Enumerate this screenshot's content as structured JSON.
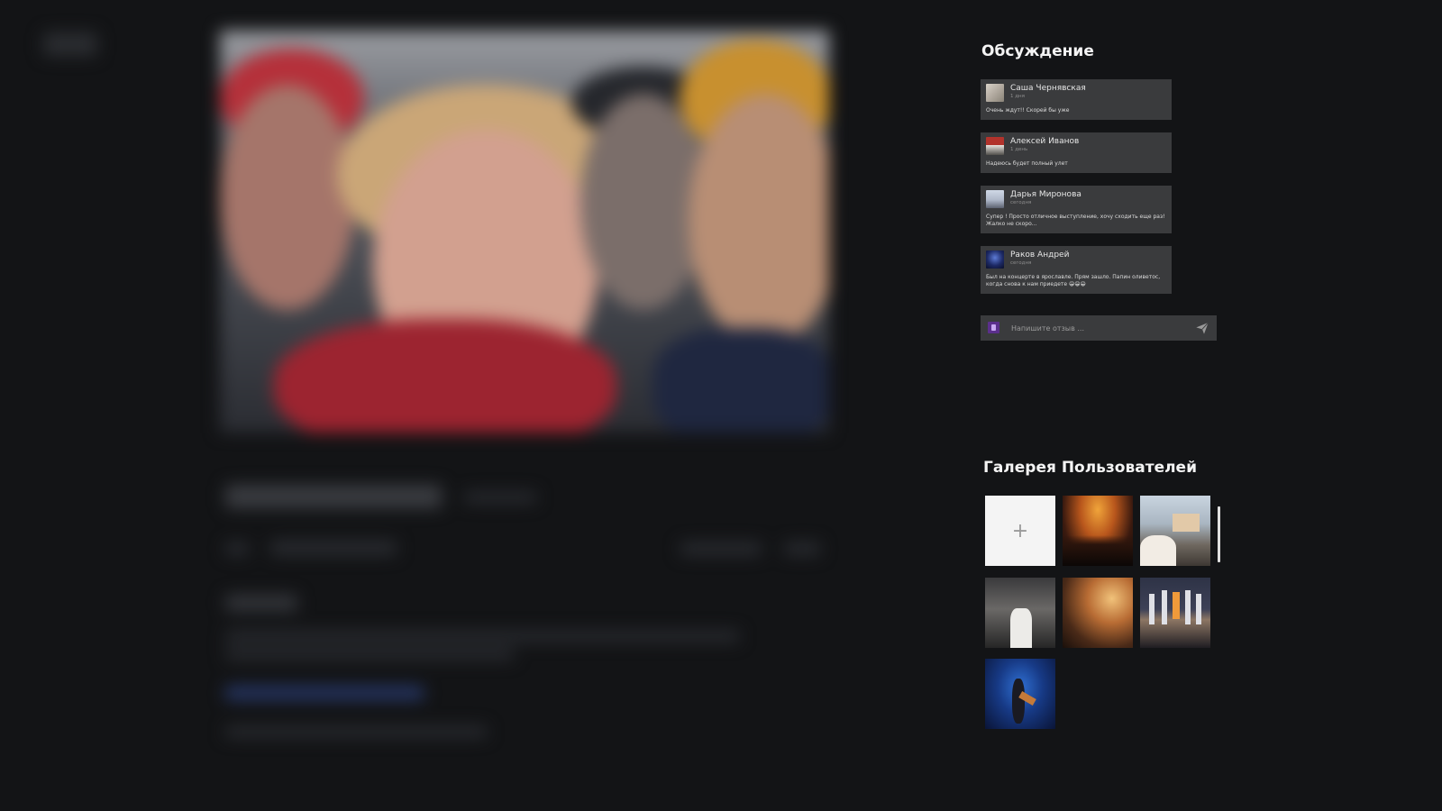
{
  "discussion": {
    "title": "Обсуждение",
    "comments": [
      {
        "author": "Саша Чернявская",
        "time": "1 дня",
        "text": "Очень ждут!! Скорей бы уже"
      },
      {
        "author": "Алексей Иванов",
        "time": "1 день",
        "text": "Надеюсь будет полный улет"
      },
      {
        "author": "Дарья Миронова",
        "time": "сегодня",
        "text": "Супер ! Просто отличное выступление, хочу сходить еще раз! Жалко не скоро..."
      },
      {
        "author": "Раков Андрей",
        "time": "сегодня",
        "text": "Был на концерте в ярославле. Прям зашло. Папин оливетос, когда снова к нам приедете 😁😁😁"
      }
    ]
  },
  "review": {
    "placeholder": "Напишите отзыв ..."
  },
  "gallery": {
    "title": "Галерея Пользователей",
    "add_label": "+"
  },
  "icons": {
    "send": "send-icon",
    "add": "plus-icon"
  },
  "colors": {
    "background": "#131416",
    "card": "#3a3b3d"
  }
}
